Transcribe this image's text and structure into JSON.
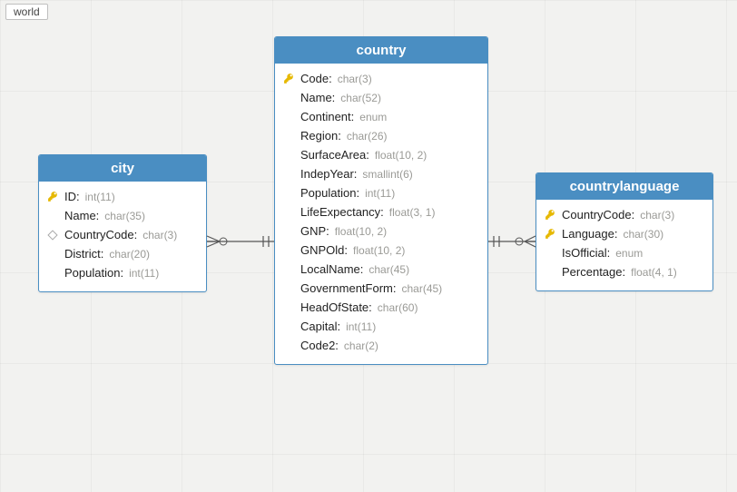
{
  "schema": {
    "name": "world"
  },
  "entities": {
    "city": {
      "title": "city",
      "columns": [
        {
          "name": "ID",
          "type": "int(11)",
          "icon": "key"
        },
        {
          "name": "Name",
          "type": "char(35)",
          "icon": ""
        },
        {
          "name": "CountryCode",
          "type": "char(3)",
          "icon": "fk"
        },
        {
          "name": "District",
          "type": "char(20)",
          "icon": ""
        },
        {
          "name": "Population",
          "type": "int(11)",
          "icon": ""
        }
      ]
    },
    "country": {
      "title": "country",
      "columns": [
        {
          "name": "Code",
          "type": "char(3)",
          "icon": "key"
        },
        {
          "name": "Name",
          "type": "char(52)",
          "icon": ""
        },
        {
          "name": "Continent",
          "type": "enum",
          "icon": ""
        },
        {
          "name": "Region",
          "type": "char(26)",
          "icon": ""
        },
        {
          "name": "SurfaceArea",
          "type": "float(10, 2)",
          "icon": ""
        },
        {
          "name": "IndepYear",
          "type": "smallint(6)",
          "icon": ""
        },
        {
          "name": "Population",
          "type": "int(11)",
          "icon": ""
        },
        {
          "name": "LifeExpectancy",
          "type": "float(3, 1)",
          "icon": ""
        },
        {
          "name": "GNP",
          "type": "float(10, 2)",
          "icon": ""
        },
        {
          "name": "GNPOld",
          "type": "float(10, 2)",
          "icon": ""
        },
        {
          "name": "LocalName",
          "type": "char(45)",
          "icon": ""
        },
        {
          "name": "GovernmentForm",
          "type": "char(45)",
          "icon": ""
        },
        {
          "name": "HeadOfState",
          "type": "char(60)",
          "icon": ""
        },
        {
          "name": "Capital",
          "type": "int(11)",
          "icon": ""
        },
        {
          "name": "Code2",
          "type": "char(2)",
          "icon": ""
        }
      ]
    },
    "countrylanguage": {
      "title": "countrylanguage",
      "columns": [
        {
          "name": "CountryCode",
          "type": "char(3)",
          "icon": "key"
        },
        {
          "name": "Language",
          "type": "char(30)",
          "icon": "key"
        },
        {
          "name": "IsOfficial",
          "type": "enum",
          "icon": ""
        },
        {
          "name": "Percentage",
          "type": "float(4, 1)",
          "icon": ""
        }
      ]
    }
  }
}
